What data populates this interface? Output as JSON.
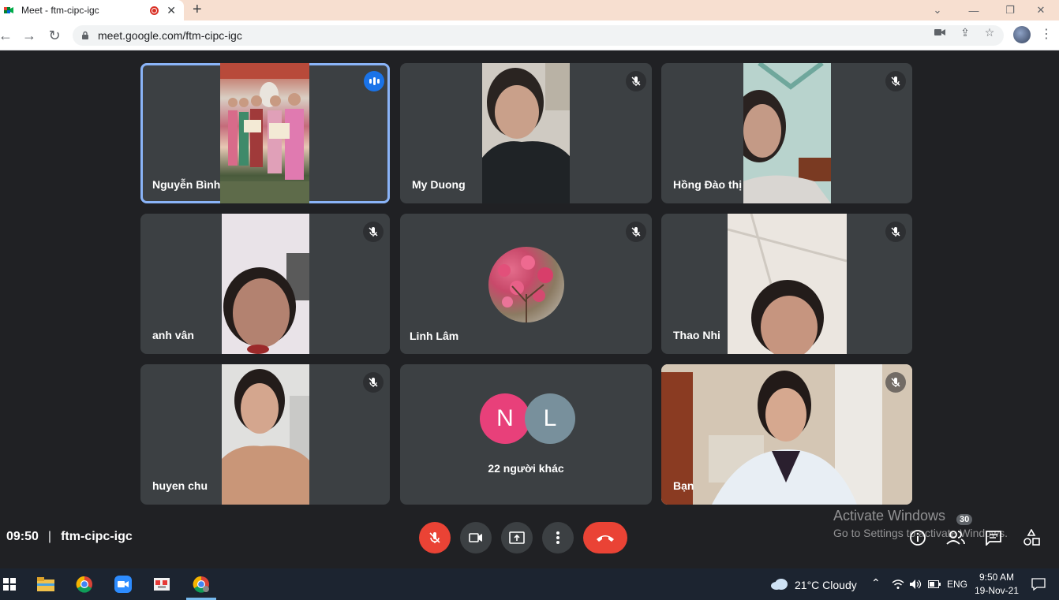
{
  "browser": {
    "tab_title": "Meet - ftm-cipc-igc",
    "url": "meet.google.com/ftm-cipc-igc",
    "new_tab_label": "+"
  },
  "participants": [
    {
      "name": "Nguyễn Bình",
      "speaking": true
    },
    {
      "name": "My Duong",
      "muted": true
    },
    {
      "name": "Hồng Đào thị",
      "muted": true
    },
    {
      "name": "anh vân",
      "muted": true
    },
    {
      "name": "Linh Lâm",
      "muted": true
    },
    {
      "name": "Thao Nhi",
      "muted": true
    },
    {
      "name": "huyen chu",
      "muted": true
    },
    {
      "name": "Bạn",
      "muted": true
    }
  ],
  "others": {
    "initials": [
      "N",
      "L"
    ],
    "label": "22 người khác"
  },
  "meeting": {
    "time": "09:50",
    "separator": "|",
    "code": "ftm-cipc-igc",
    "participant_count": "30"
  },
  "watermark": {
    "line1": "Activate Windows",
    "line2": "Go to Settings to activate Windows."
  },
  "taskbar": {
    "weather": "21°C  Cloudy",
    "lang": "ENG",
    "clock_time": "9:50 AM",
    "clock_date": "19-Nov-21"
  },
  "colors": {
    "accent_blue": "#1a73e8",
    "end_call_red": "#ea4335",
    "meet_bg": "#202124",
    "tile_bg": "#3c4043"
  }
}
